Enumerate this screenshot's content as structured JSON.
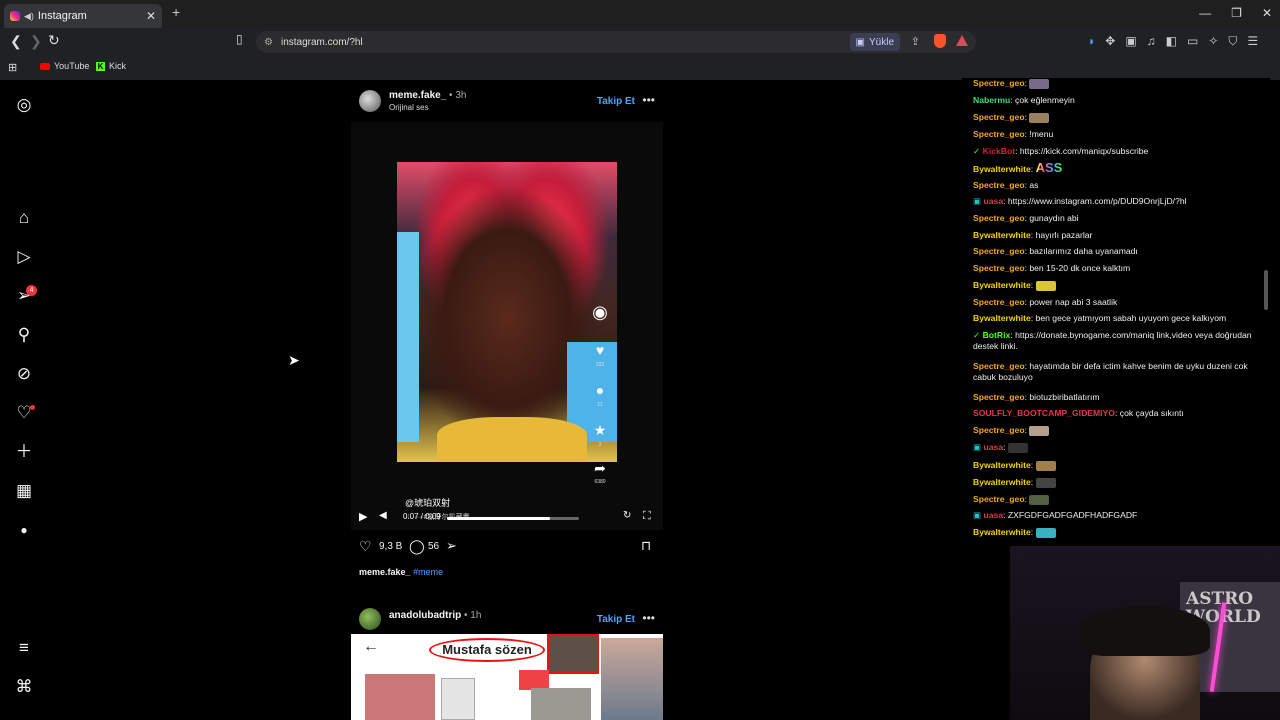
{
  "browser": {
    "tab_title": "Instagram",
    "url": "instagram.com/?hl",
    "upload_label": "Yükle",
    "bookmarks": [
      "YouTube",
      "Kick"
    ]
  },
  "sidebar": {
    "notification_count": "4",
    "items": [
      "instagram-logo",
      "home",
      "reels",
      "messages",
      "search",
      "explore",
      "notifications",
      "create",
      "dashboard",
      "profile",
      "more",
      "also-from-meta"
    ]
  },
  "post1": {
    "username": "meme.fake_",
    "time": "• 3h",
    "audio": "Orijinal ses",
    "follow_label": "Takip Et",
    "video_caption_cn": "@琥珀双射",
    "video_caption_cn2": "········#象牙尔凯藏畫",
    "video_time": "0:07 / 0:09",
    "progress": 0.78,
    "side_counts": [
      "322",
      "11",
      "2",
      "6380"
    ],
    "likes": "9,3 B",
    "comments": "56",
    "caption_user": "meme.fake_",
    "caption_tag": "#meme"
  },
  "post2": {
    "username": "anadolubadtrip",
    "time": "• 1h",
    "follow_label": "Takip Et",
    "thumb_text": "Mustafa sözen"
  },
  "chat": {
    "messages": [
      {
        "user": "Spectre_geo",
        "color": "#f5a623",
        "text": "",
        "emote": "#7a6a8a"
      },
      {
        "user": "Nabermu",
        "color": "#3ddc84",
        "text": "çok eğlenmeyin"
      },
      {
        "user": "Spectre_geo",
        "color": "#f5a623",
        "text": "",
        "emote": "#9a8060"
      },
      {
        "user": "Spectre_geo",
        "color": "#f5a623",
        "text": "!menu"
      },
      {
        "user": "KickBot",
        "color": "#d91e3f",
        "text": "https://kick.com/maniqx/subscribe",
        "badge": "✓"
      },
      {
        "user": "Bywalterwhite",
        "color": "#f2d200",
        "text": "ASS",
        "ass": true
      },
      {
        "user": "Spectre_geo",
        "color": "#f5a623",
        "text": "as"
      },
      {
        "user": "uasa",
        "color": "#e8344e",
        "text": "https://www.instagram.com/p/DUD9OnrjLjD/?hl",
        "badge": "▣"
      },
      {
        "user": "Spectre_geo",
        "color": "#f5a623",
        "text": "gunaydın abi"
      },
      {
        "user": "Bywalterwhite",
        "color": "#f2d200",
        "text": "hayırlı pazarlar"
      },
      {
        "user": "Spectre_geo",
        "color": "#f5a623",
        "text": "bazılarımız daha uyanamadı"
      },
      {
        "user": "Spectre_geo",
        "color": "#f5a623",
        "text": "ben 15-20 dk once kalktım"
      },
      {
        "user": "Bywalterwhite",
        "color": "#f2d200",
        "text": "",
        "emote": "#d9c53a"
      },
      {
        "user": "Spectre_geo",
        "color": "#f5a623",
        "text": "power nap abi 3 saatlik"
      },
      {
        "user": "Bywalterwhite",
        "color": "#f2d200",
        "text": "ben gece yatmıyom sabah uyuyom gece kalkıyom"
      },
      {
        "user": "BotRix",
        "color": "#53fc18",
        "text": "https://donate.bynogame.com/maniq link,video veya doğrudan destek linki.",
        "badge": "✓"
      },
      {
        "user": "Spectre_geo",
        "color": "#f5a623",
        "text": "hayatımda bir defa ictim kahve benim de uyku duzeni cok cabuk bozuluyo"
      },
      {
        "user": "Spectre_geo",
        "color": "#f5a623",
        "text": "biotuzbiribatlatırım"
      },
      {
        "user": "SOULFLY_BOOTCAMP_GIDEMIYO",
        "color": "#e8344e",
        "text": "çok çayda sıkıntı"
      },
      {
        "user": "Spectre_geo",
        "color": "#f5a623",
        "text": "",
        "emote": "#b5a090"
      },
      {
        "user": "uasa",
        "color": "#e8344e",
        "text": "",
        "badge": "▣",
        "emote": "#333"
      },
      {
        "user": "Bywalterwhite",
        "color": "#f2d200",
        "text": "",
        "emote": "#a0804a"
      },
      {
        "user": "Bywalterwhite",
        "color": "#f2d200",
        "text": "",
        "emote": "#444"
      },
      {
        "user": "Spectre_geo",
        "color": "#f5a623",
        "text": "",
        "emote": "#556040"
      },
      {
        "user": "uasa",
        "color": "#e8344e",
        "text": "ZXFGDFGADFGADFHADFGADF",
        "badge": "▣"
      },
      {
        "user": "Bywalterwhite",
        "color": "#f2d200",
        "text": "",
        "emote": "#3ab0c0"
      }
    ]
  },
  "webcam": {
    "poster_text": "ASTRO WORLD"
  }
}
